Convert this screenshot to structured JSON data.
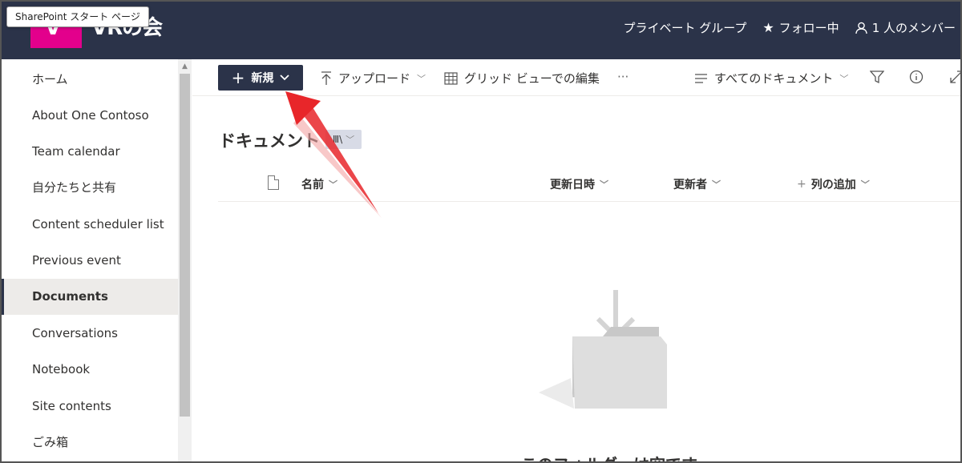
{
  "tooltip": "SharePoint スタート ページ",
  "site": {
    "title": "VRの会",
    "logo_letter": "V",
    "brand_color": "#e3008c",
    "header_color": "#2b3349"
  },
  "header": {
    "group_type": "プライベート グループ",
    "follow_label": "フォロー中",
    "members_label": "1 人のメンバー"
  },
  "nav": {
    "items": [
      {
        "label": "ホーム"
      },
      {
        "label": "About One Contoso"
      },
      {
        "label": "Team calendar"
      },
      {
        "label": "自分たちと共有"
      },
      {
        "label": "Content scheduler list"
      },
      {
        "label": "Previous event"
      },
      {
        "label": "Documents",
        "active": true
      },
      {
        "label": "Conversations"
      },
      {
        "label": "Notebook"
      },
      {
        "label": "Site contents"
      },
      {
        "label": "ごみ箱"
      }
    ]
  },
  "commands": {
    "new_label": "新規",
    "upload_label": "アップロード",
    "grid_edit_label": "グリッド ビューでの編集",
    "more_label": "···",
    "view_label": "すべてのドキュメント"
  },
  "library": {
    "title": "ドキュメント",
    "columns": {
      "name": "名前",
      "modified": "更新日時",
      "modified_by": "更新者",
      "add_column": "列の追加"
    },
    "empty_message": "このフォルダーは空です"
  },
  "annotation": {
    "arrow_color": "#e8262a"
  }
}
